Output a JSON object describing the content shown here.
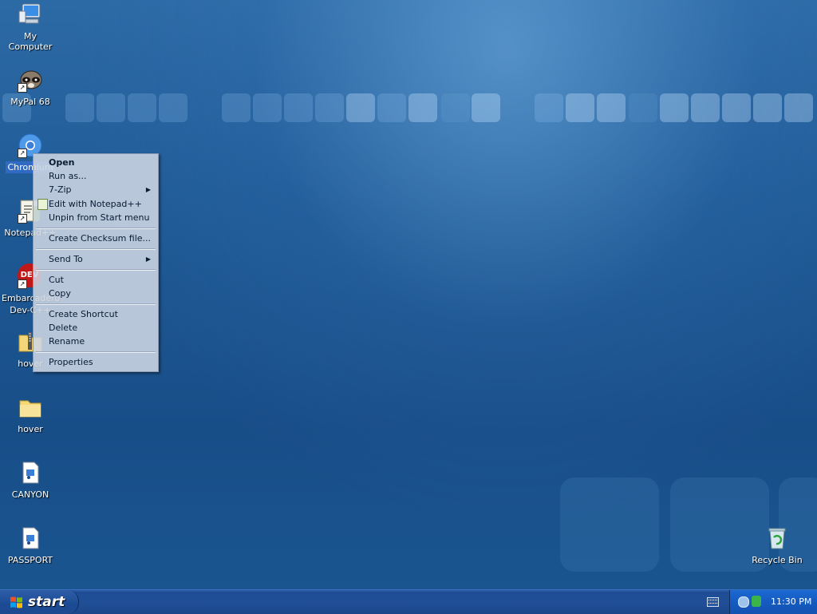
{
  "desktop": {
    "icons": [
      {
        "label": "My Computer"
      },
      {
        "label": "MyPal 68"
      },
      {
        "label": "Chromium"
      },
      {
        "label": "Notepad++"
      },
      {
        "label": "Embarcadero Dev-C++",
        "line1": "Embarcadero",
        "line2": "Dev-C++",
        "badge": "DEV"
      },
      {
        "label": "hover"
      },
      {
        "label": "hover"
      },
      {
        "label": "CANYON"
      },
      {
        "label": "PASSPORT"
      },
      {
        "label": "Recycle Bin"
      }
    ]
  },
  "context_menu": {
    "items": [
      {
        "label": "Open"
      },
      {
        "label": "Run as..."
      },
      {
        "label": "7-Zip"
      },
      {
        "label": "Edit with Notepad++"
      },
      {
        "label": "Unpin from Start menu"
      },
      {
        "label": "Create Checksum file..."
      },
      {
        "label": "Send To"
      },
      {
        "label": "Cut"
      },
      {
        "label": "Copy"
      },
      {
        "label": "Create Shortcut"
      },
      {
        "label": "Delete"
      },
      {
        "label": "Rename"
      },
      {
        "label": "Properties"
      }
    ],
    "submenu_arrow": "▶"
  },
  "taskbar": {
    "start_label": "start",
    "clock": "11:30 PM"
  },
  "colors": {
    "desktop_blue": "#1f5a96",
    "selection": "#316ac5",
    "taskbar": "#214f97",
    "tray": "#155bc0"
  }
}
